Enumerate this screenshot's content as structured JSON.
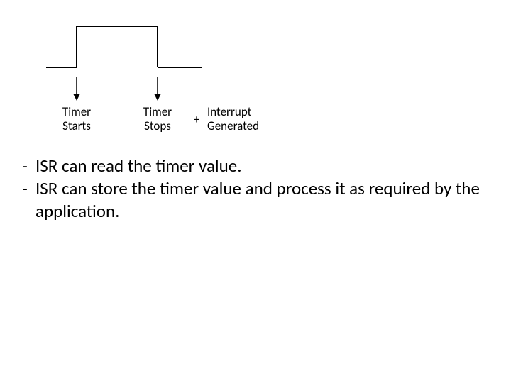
{
  "chart_data": {
    "type": "line",
    "title": "",
    "xlabel": "",
    "ylabel": "",
    "series": [
      {
        "name": "signal",
        "x": [
          0,
          40,
          40,
          155,
          155,
          220
        ],
        "y": [
          0,
          0,
          1,
          1,
          0,
          0
        ]
      }
    ],
    "annotations": [
      {
        "x": 40,
        "text": "Timer Starts",
        "arrow": "down"
      },
      {
        "x": 155,
        "text": "Timer Stops",
        "arrow": "down"
      },
      {
        "text": "+"
      },
      {
        "text": "Interrupt Generated"
      }
    ],
    "ylim": [
      0,
      1
    ]
  },
  "labels": {
    "start_l1": "Timer",
    "start_l2": "Starts",
    "stop_l1": "Timer",
    "stop_l2": "Stops",
    "plus": "+",
    "int_l1": "Interrupt",
    "int_l2": "Generated"
  },
  "bullets": [
    "ISR can read the timer value.",
    "ISR can store the timer value and process it as required by the application."
  ]
}
